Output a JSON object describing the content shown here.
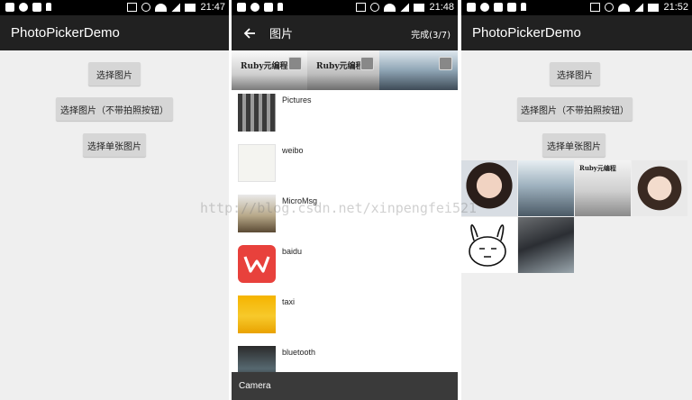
{
  "status_times": [
    "21:47",
    "21:48",
    "21:52"
  ],
  "screen1": {
    "app_title": "PhotoPickerDemo",
    "buttons": [
      "选择图片",
      "选择图片（不带拍照按钮）",
      "选择单张图片"
    ]
  },
  "screen2": {
    "title": "图片",
    "done_label": "完成(3/7)",
    "preview_captions": [
      "Ruby元编程",
      "Ruby元编程"
    ],
    "folders": [
      "Pictures",
      "weibo",
      "MicroMsg",
      "baidu",
      "taxi",
      "bluetooth"
    ],
    "bottom_label": "Camera"
  },
  "screen3": {
    "app_title": "PhotoPickerDemo",
    "buttons": [
      "选择图片",
      "选择图片（不带拍照按钮）",
      "选择单张图片"
    ],
    "photo_names": [
      "selfie-girl-1",
      "office-room",
      "book-cover",
      "selfie-girl-2",
      "bunny-sticker",
      "laptop-desk"
    ],
    "book_caption": "Ruby元编程"
  },
  "watermark": "http://blog.csdn.net/xinpengfei521",
  "colors": {
    "appbar": "#212121",
    "statusbar": "#000000",
    "background": "#efefef",
    "button": "#d6d6d6"
  }
}
